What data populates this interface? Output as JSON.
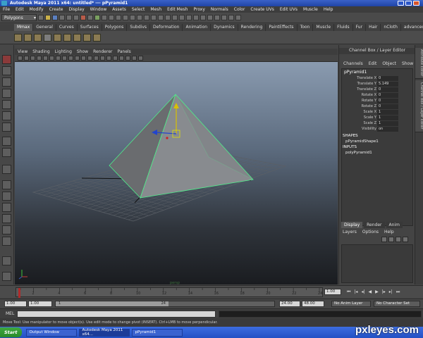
{
  "window": {
    "title": "Autodesk Maya 2011 x64: untitled*   ---   pPyramid1"
  },
  "menubar": {
    "items": [
      "File",
      "Edit",
      "Modify",
      "Create",
      "Display",
      "Window",
      "Assets",
      "Select",
      "Mesh",
      "Edit Mesh",
      "Proxy",
      "Normals",
      "Color",
      "Create UVs",
      "Edit UVs",
      "Muscle",
      "Help"
    ]
  },
  "statusline": {
    "mode": "Polygons"
  },
  "shelf": {
    "tabs": [
      "Mmax",
      "General",
      "Curves",
      "Surfaces",
      "Polygons",
      "Subdivs",
      "Deformation",
      "Animation",
      "Dynamics",
      "Rendering",
      "PaintEffects",
      "Toon",
      "Muscle",
      "Fluids",
      "Fur",
      "Hair",
      "nCloth",
      "advancedSkeleton"
    ],
    "active_tab": "Mmax"
  },
  "panel": {
    "menu": [
      "View",
      "Shading",
      "Lighting",
      "Show",
      "Renderer",
      "Panels"
    ],
    "view_label": "persp"
  },
  "channel_box": {
    "title": "Channel Box / Layer Editor",
    "menu": [
      "Channels",
      "Edit",
      "Object",
      "Show"
    ],
    "object": "pPyramid1",
    "attributes": [
      {
        "name": "Translate X",
        "value": "0"
      },
      {
        "name": "Translate Y",
        "value": "5.149"
      },
      {
        "name": "Translate Z",
        "value": "0"
      },
      {
        "name": "Rotate X",
        "value": "0"
      },
      {
        "name": "Rotate Y",
        "value": "0"
      },
      {
        "name": "Rotate Z",
        "value": "0"
      },
      {
        "name": "Scale X",
        "value": "1"
      },
      {
        "name": "Scale Y",
        "value": "1"
      },
      {
        "name": "Scale Z",
        "value": "1"
      },
      {
        "name": "Visibility",
        "value": "on"
      }
    ],
    "shapes_label": "SHAPES",
    "shape": "pPyramidShape1",
    "inputs_label": "INPUTS",
    "input": "polyPyramid1"
  },
  "layer_editor": {
    "tabs": [
      "Display",
      "Render",
      "Anim"
    ],
    "active_tab": "Display",
    "menu": [
      "Layers",
      "Options",
      "Help"
    ]
  },
  "side_tabs": [
    "Attribute Editor",
    "Channel Box / Layer Editor"
  ],
  "timeline": {
    "ticks": [
      "2",
      "4",
      "6",
      "8",
      "10",
      "12",
      "14",
      "16",
      "18",
      "20",
      "22",
      "24"
    ],
    "current_time": "1.00"
  },
  "range": {
    "start": "1.00",
    "playback_start": "1.00",
    "handle_start": "1",
    "handle_end": "24",
    "playback_end": "24.00",
    "end": "48.00",
    "anim_layer": "No Anim Layer",
    "character_set": "No Character Set"
  },
  "command": {
    "label": "MEL"
  },
  "help_line": {
    "text": "Move Tool: Use manipulator to move object(s). Use edit mode to change pivot (INSERT). Ctrl+LMB to move perpendicular."
  },
  "taskbar": {
    "start": "Start",
    "tasks": [
      "Output Window",
      "Autodesk Maya 2011 x64...",
      "pPyramid1"
    ]
  },
  "watermark": "pxleyes.com"
}
